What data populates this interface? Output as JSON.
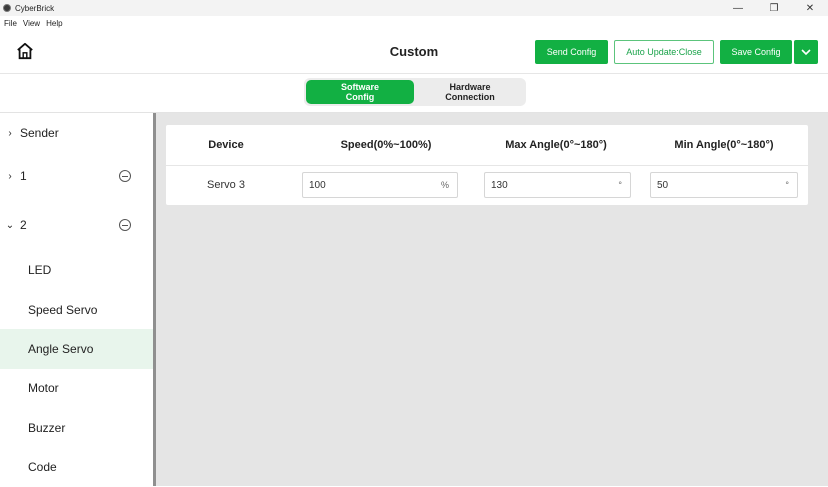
{
  "window": {
    "title": "CyberBrick"
  },
  "menu": [
    "File",
    "View",
    "Help"
  ],
  "header": {
    "title": "Custom",
    "send_config": "Send Config",
    "auto_update": "Auto Update:Close",
    "save_config": "Save Config"
  },
  "tabs": {
    "software": "Software\nConfig",
    "hardware": "Hardware\nConnection"
  },
  "sidebar": {
    "sender": "Sender",
    "group1": "1",
    "group2": "2",
    "items": [
      "LED",
      "Speed Servo",
      "Angle Servo",
      "Motor",
      "Buzzer",
      "Code"
    ]
  },
  "table": {
    "headers": [
      "Device",
      "Speed(0%~100%)",
      "Max Angle(0°~180°)",
      "Min Angle(0°~180°)"
    ],
    "row": {
      "device": "Servo 3",
      "speed": "100",
      "speed_unit": "%",
      "max_angle": "130",
      "max_unit": "°",
      "min_angle": "50",
      "min_unit": "°"
    }
  },
  "colors": {
    "accent": "#12b043",
    "selected_bg": "#e8f5ec"
  }
}
